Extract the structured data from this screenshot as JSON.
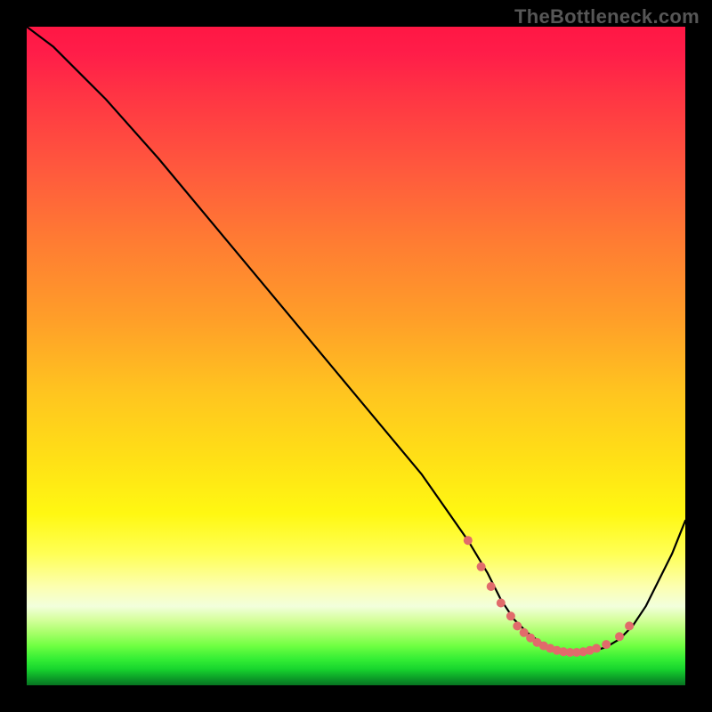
{
  "watermark": "TheBottleneck.com",
  "colors": {
    "background": "#000000",
    "curve": "#000000",
    "marker": "#e16b6b",
    "gradient_stops": [
      "#ff1744",
      "#ff5a3d",
      "#ff9d29",
      "#ffe116",
      "#fcffb0",
      "#70ff42",
      "#18d62e",
      "#087321"
    ]
  },
  "chart_data": {
    "type": "line",
    "title": "",
    "xlabel": "",
    "ylabel": "",
    "xlim": [
      0,
      100
    ],
    "ylim": [
      0,
      100
    ],
    "grid": false,
    "series": [
      {
        "name": "curve",
        "x": [
          0,
          4,
          8,
          12,
          20,
          30,
          40,
          50,
          60,
          67,
          70,
          72,
          74,
          76,
          78,
          80,
          82,
          84,
          86,
          88,
          90,
          92,
          94,
          96,
          98,
          100
        ],
        "y": [
          100,
          97,
          93,
          89,
          80,
          68,
          56,
          44,
          32,
          22,
          17,
          13,
          10,
          8,
          6.5,
          5.5,
          5,
          5,
          5.2,
          5.8,
          7,
          9,
          12,
          16,
          20,
          25
        ]
      }
    ],
    "markers": {
      "name": "highlighted-points",
      "x": [
        67,
        69,
        70.5,
        72,
        73.5,
        74.5,
        75.5,
        76.5,
        77.5,
        78.5,
        79.5,
        80.5,
        81.5,
        82.5,
        83.5,
        84.5,
        85.5,
        86.5,
        88,
        90,
        91.5
      ],
      "y": [
        22,
        18,
        15,
        12.5,
        10.5,
        9,
        8,
        7.2,
        6.5,
        6,
        5.6,
        5.3,
        5.1,
        5,
        5,
        5.1,
        5.3,
        5.6,
        6.2,
        7.4,
        9
      ]
    }
  }
}
